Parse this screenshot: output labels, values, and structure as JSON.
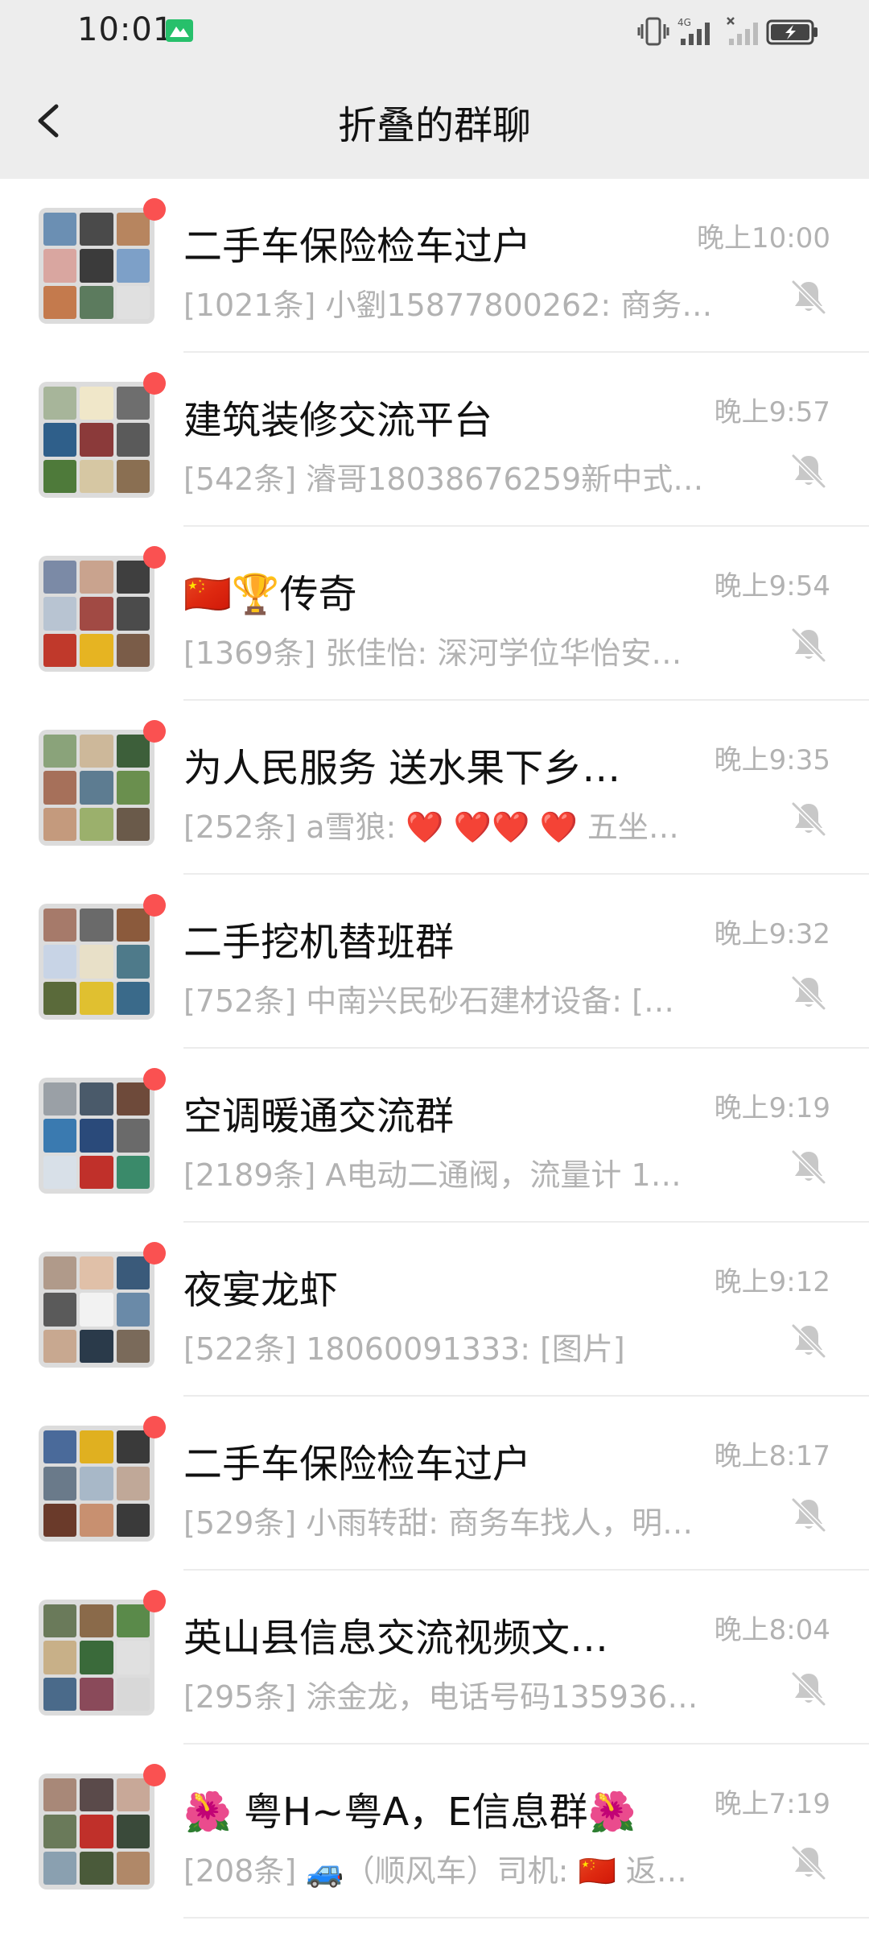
{
  "status": {
    "time": "10:01",
    "network": "4G"
  },
  "header": {
    "title": "折叠的群聊"
  },
  "colors": {
    "unread": "#fa5151",
    "muted_text": "#b2b2b2",
    "header_bg": "#ededed"
  },
  "chats": [
    {
      "name": "二手车保险检车过户",
      "time": "晚上10:00",
      "preview": "[1021条] 小劉15877800262: 商务…",
      "muted_icon": "bell-off-icon"
    },
    {
      "name": "建筑装修交流平台",
      "time": "晚上9:57",
      "preview": "[542条] 濬哥18038676259新中式…",
      "muted_icon": "bell-off-icon"
    },
    {
      "name": "🇨🇳🏆传奇",
      "time": "晚上9:54",
      "preview": "[1369条] 张佳怡: 深河学位华怡安…",
      "muted_icon": "bell-off-icon"
    },
    {
      "name": "为人民服务  送水果下乡…",
      "time": "晚上9:35",
      "preview": "[252条] a雪狼: ❤️ ❤️❤️ ❤️  五坐…",
      "muted_icon": "bell-off-icon"
    },
    {
      "name": "二手挖机替班群",
      "time": "晚上9:32",
      "preview": "[752条] 中南兴民砂石建材设备: […",
      "muted_icon": "bell-off-icon"
    },
    {
      "name": "空调暖通交流群",
      "time": "晚上9:19",
      "preview": "[2189条] A电动二通阀，流量计  1…",
      "muted_icon": "bell-off-icon"
    },
    {
      "name": "夜宴龙虾",
      "time": "晚上9:12",
      "preview": "[522条] 18060091333: [图片]",
      "muted_icon": "bell-off-icon"
    },
    {
      "name": "二手车保险检车过户",
      "time": "晚上8:17",
      "preview": "[529条] 小雨转甜: 商务车找人，明…",
      "muted_icon": "bell-off-icon"
    },
    {
      "name": "英山县信息交流视频文…",
      "time": "晚上8:04",
      "preview": "[295条] 涂金龙，电话号码135936…",
      "muted_icon": "bell-off-icon"
    },
    {
      "name": "🌺 粤H~粤A，E信息群🌺",
      "time": "晚上7:19",
      "preview": "[208条] 🚙（顺风车）司机: 🇨🇳  返…",
      "muted_icon": "bell-off-icon"
    }
  ]
}
